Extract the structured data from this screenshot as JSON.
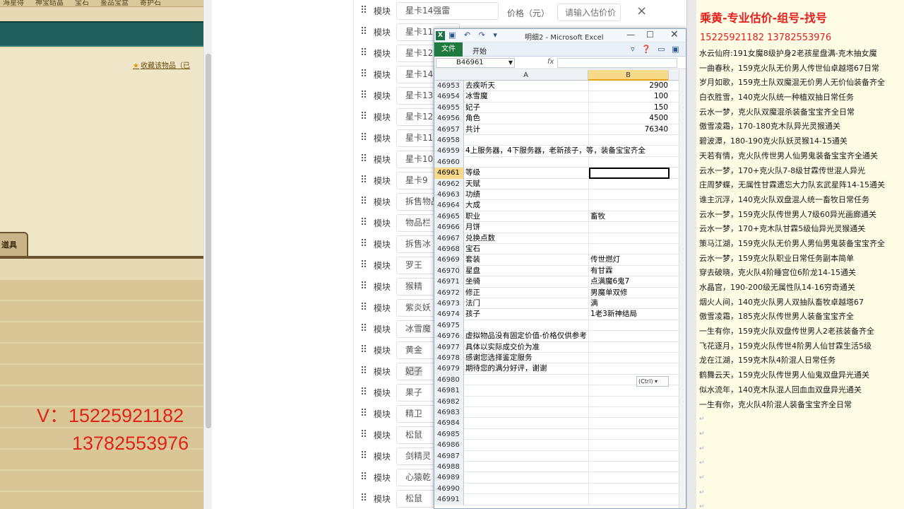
{
  "game": {
    "topbar_items": [
      "海星得",
      "神宝结晶",
      "宝石",
      "鉴品宝盒",
      "寄护石"
    ],
    "collect_link": "收藏该物品（已",
    "prop_tab": "道具",
    "phone_1": "V：15225921182",
    "phone_2": "13782553976"
  },
  "form": {
    "module_label": "模块",
    "price_label": "价格（元）",
    "price_placeholder": "请输入估价价",
    "close_icon": "×",
    "rows": [
      "星卡14强雷",
      "星卡11",
      "星卡12",
      "星卡14",
      "星卡13",
      "星卡12",
      "星卡11",
      "星卡10",
      "星卡9",
      "拆售物品",
      "物品栏",
      "拆售冰",
      "罗王",
      "猴精",
      "紫炎妖",
      "冰雪魔",
      "黄金",
      "妃子",
      "果子",
      "精卫",
      "松鼠",
      "剑精灵",
      "心猿乾",
      "松鼠"
    ]
  },
  "excel": {
    "title": "明细2 - Microsoft Excel",
    "qat": "▣ ↶ ↷ ▾",
    "file_tab": "文件",
    "home_tab": "开始",
    "name_box": "B46961",
    "fx": "fx",
    "col_a": "A",
    "col_b": "B",
    "ctrl_tag": "(Ctrl) ▾",
    "rows": [
      {
        "n": "46953",
        "a": "去疾听天",
        "b": "2900",
        "num": true
      },
      {
        "n": "46954",
        "a": "冰雪魔",
        "b": "100",
        "num": true
      },
      {
        "n": "46955",
        "a": "妃子",
        "b": "150",
        "num": true
      },
      {
        "n": "46956",
        "a": "角色",
        "b": "4500",
        "num": true
      },
      {
        "n": "46957",
        "a": "共计",
        "b": "76340",
        "num": true
      },
      {
        "n": "46958",
        "a": "",
        "b": ""
      },
      {
        "n": "46959",
        "a": "4上服务器，4下服务器，老新孩子，等，装备宝宝齐全",
        "b": ""
      },
      {
        "n": "46960",
        "a": "",
        "b": ""
      },
      {
        "n": "46961",
        "a": "等级",
        "b": "",
        "active": true
      },
      {
        "n": "46962",
        "a": "天赋",
        "b": ""
      },
      {
        "n": "46963",
        "a": "功绩",
        "b": ""
      },
      {
        "n": "46964",
        "a": "大成",
        "b": ""
      },
      {
        "n": "46965",
        "a": "职业",
        "b": "畜牧"
      },
      {
        "n": "46966",
        "a": "月饼",
        "b": ""
      },
      {
        "n": "46967",
        "a": "兑换点数",
        "b": ""
      },
      {
        "n": "46968",
        "a": "宝石",
        "b": ""
      },
      {
        "n": "46969",
        "a": "套装",
        "b": "传世燃灯"
      },
      {
        "n": "46970",
        "a": "星盘",
        "b": "有甘霖"
      },
      {
        "n": "46971",
        "a": "坐骑",
        "b": "点满魔6鬼7"
      },
      {
        "n": "46972",
        "a": "修正",
        "b": "男魔单双修"
      },
      {
        "n": "46973",
        "a": "法门",
        "b": "满"
      },
      {
        "n": "46974",
        "a": "孩子",
        "b": "1老3新神结局"
      },
      {
        "n": "46975",
        "a": "",
        "b": ""
      },
      {
        "n": "46976",
        "a": "虚拟物品没有固定价值-价格仅供参考",
        "b": ""
      },
      {
        "n": "46977",
        "a": "具体以实际成交价为准",
        "b": ""
      },
      {
        "n": "46978",
        "a": "感谢您选择鉴定服务",
        "b": ""
      },
      {
        "n": "46979",
        "a": "期待您的满分好评，谢谢",
        "b": ""
      },
      {
        "n": "46980",
        "a": "",
        "b": ""
      },
      {
        "n": "46981",
        "a": "",
        "b": ""
      },
      {
        "n": "46982",
        "a": "",
        "b": ""
      },
      {
        "n": "46983",
        "a": "",
        "b": ""
      },
      {
        "n": "46984",
        "a": "",
        "b": ""
      },
      {
        "n": "46985",
        "a": "",
        "b": ""
      },
      {
        "n": "46986",
        "a": "",
        "b": ""
      },
      {
        "n": "46987",
        "a": "",
        "b": ""
      },
      {
        "n": "46988",
        "a": "",
        "b": ""
      },
      {
        "n": "46989",
        "a": "",
        "b": ""
      },
      {
        "n": "46990",
        "a": "",
        "b": ""
      },
      {
        "n": "46991",
        "a": "",
        "b": ""
      }
    ]
  },
  "note": {
    "title": "乘黄-专业估价-组号-找号",
    "phones": "15225921182    13782553976",
    "lines": [
      "水云仙府:191女魔8级护身2老孩星盘满-克木抽女魔",
      "一曲春秋，159克火队无价男人传世仙卓越塔67日常",
      "岁月如歌，159克土队双魔混无价男人无价仙装备齐全",
      "白衣胜雪，140克火队统一种植双抽日常任务",
      "云水一梦，克火队双魔混杀装备宝宝齐全日常",
      "傲雪凌霜，170-180克木队异光灵猴通关",
      "碧波潭，180-190克火队妖灵猴14-15通关",
      "天若有情，克火队传世男人仙男鬼装备宝宝齐全通关",
      "云水一梦，170+克火队7-8级甘霖传世混人异光",
      "庄周梦蝶，无属性甘霖遗忘大力队玄武星阵14-15通关",
      "谁主沉浮，140克火队双盘混人统一畜牧日常任务",
      "云水一梦，159克火队传世男人7级60异光画廊通关",
      "云水一梦，170+克木队甘霖5级仙异光灵猴通关",
      "策马江湖，159克火队无价男人男仙男鬼装备宝宝齐全",
      "云水一梦，159克火队职业日常任务副本简单",
      "穿去破晓，克火队4阶睡宫位6阶龙14-15通关",
      "水晶宫，190-200级无属性队14-16穷奇通关",
      "烟火人间，140克火队男人双抽队畜牧卓越塔67",
      "傲雪凌霜，185克火队传世男人装备宝宝齐全",
      "一生有你，159克火队双盘传世男人2老孩装备齐全",
      "飞花逐月，159克火队传世4阶男人仙甘霖生活5级",
      "龙在江湖，159克木队4阶混人日常任务",
      "鹤舞云天，159克火队传世男人仙鬼双盘异光通关",
      "似水流年，140克木队混人回血血双盘异光通关",
      "一生有你，克火队4阶混人装备宝宝齐全日常",
      "↵",
      "↵",
      "↵",
      "↵",
      "↵",
      "↵",
      "↵"
    ]
  }
}
